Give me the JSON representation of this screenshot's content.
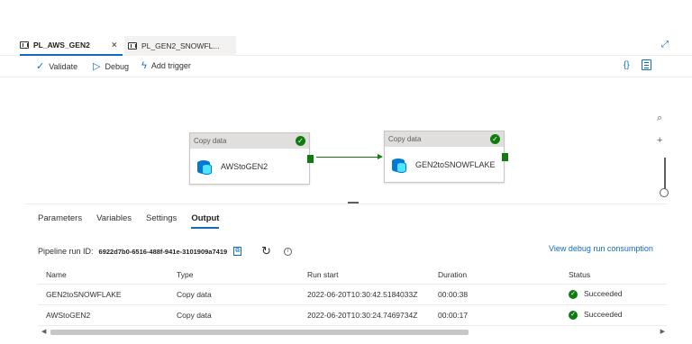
{
  "tabs": [
    {
      "label": "PL_AWS_GEN2",
      "close": "×"
    },
    {
      "label": "PL_GEN2_SNOWFL..."
    }
  ],
  "tabbar_right_icon": "expand-icon",
  "toolbar": {
    "validate_label": "Validate",
    "debug_label": "Debug",
    "add_trigger_label": "Add trigger",
    "code_icon": "{}"
  },
  "activities": [
    {
      "type": "Copy data",
      "name": "AWStoGEN2"
    },
    {
      "type": "Copy data",
      "name": "GEN2toSNOWFLAKE"
    }
  ],
  "panel": {
    "tabs": [
      "Parameters",
      "Variables",
      "Settings",
      "Output"
    ],
    "active_tab": "Output",
    "run_id_label": "Pipeline run ID:",
    "run_id_value": "6922d7b0-6516-488f-941e-3101909a7419",
    "consumption_link": "View debug run consumption",
    "columns": [
      "Name",
      "Type",
      "Run start",
      "Duration",
      "Status"
    ],
    "rows": [
      {
        "name": "GEN2toSNOWFLAKE",
        "type": "Copy data",
        "run_start": "2022-06-20T10:30:42.5184033Z",
        "duration": "00:00:38",
        "status": "Succeeded"
      },
      {
        "name": "AWStoGEN2",
        "type": "Copy data",
        "run_start": "2022-06-20T10:30:24.7469734Z",
        "duration": "00:00:17",
        "status": "Succeeded"
      }
    ]
  },
  "colors": {
    "accent": "#0f6cbd",
    "success": "#107c10"
  }
}
